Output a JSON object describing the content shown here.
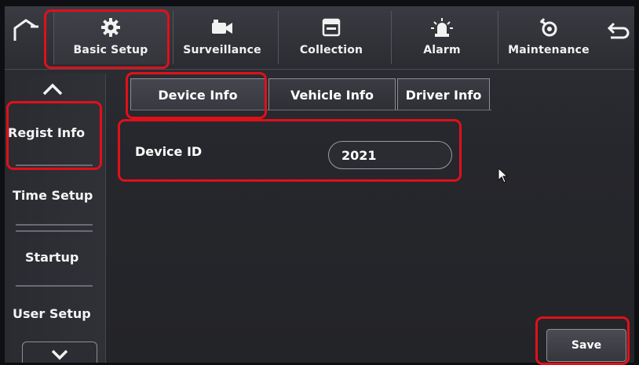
{
  "nav": {
    "tabs": [
      {
        "label": "Basic Setup",
        "icon": "gear-icon"
      },
      {
        "label": "Surveillance",
        "icon": "camera-icon"
      },
      {
        "label": "Collection",
        "icon": "storage-icon"
      },
      {
        "label": "Alarm",
        "icon": "alarm-light-icon"
      },
      {
        "label": "Maintenance",
        "icon": "maintenance-icon"
      }
    ],
    "active": "Basic Setup"
  },
  "sidebar": {
    "items": [
      {
        "label": "Regist Info"
      },
      {
        "label": "Time Setup"
      },
      {
        "label": "Startup"
      },
      {
        "label": "User Setup"
      }
    ],
    "active": "Regist Info"
  },
  "subtabs": {
    "items": [
      {
        "label": "Device Info"
      },
      {
        "label": "Vehicle Info"
      },
      {
        "label": "Driver Info"
      }
    ],
    "active": "Device Info"
  },
  "form": {
    "device_id_label": "Device ID",
    "device_id_value": "2021"
  },
  "actions": {
    "save_label": "Save"
  },
  "colors": {
    "highlight": "#e0101a",
    "background": "#26272c",
    "text": "#ffffff"
  }
}
